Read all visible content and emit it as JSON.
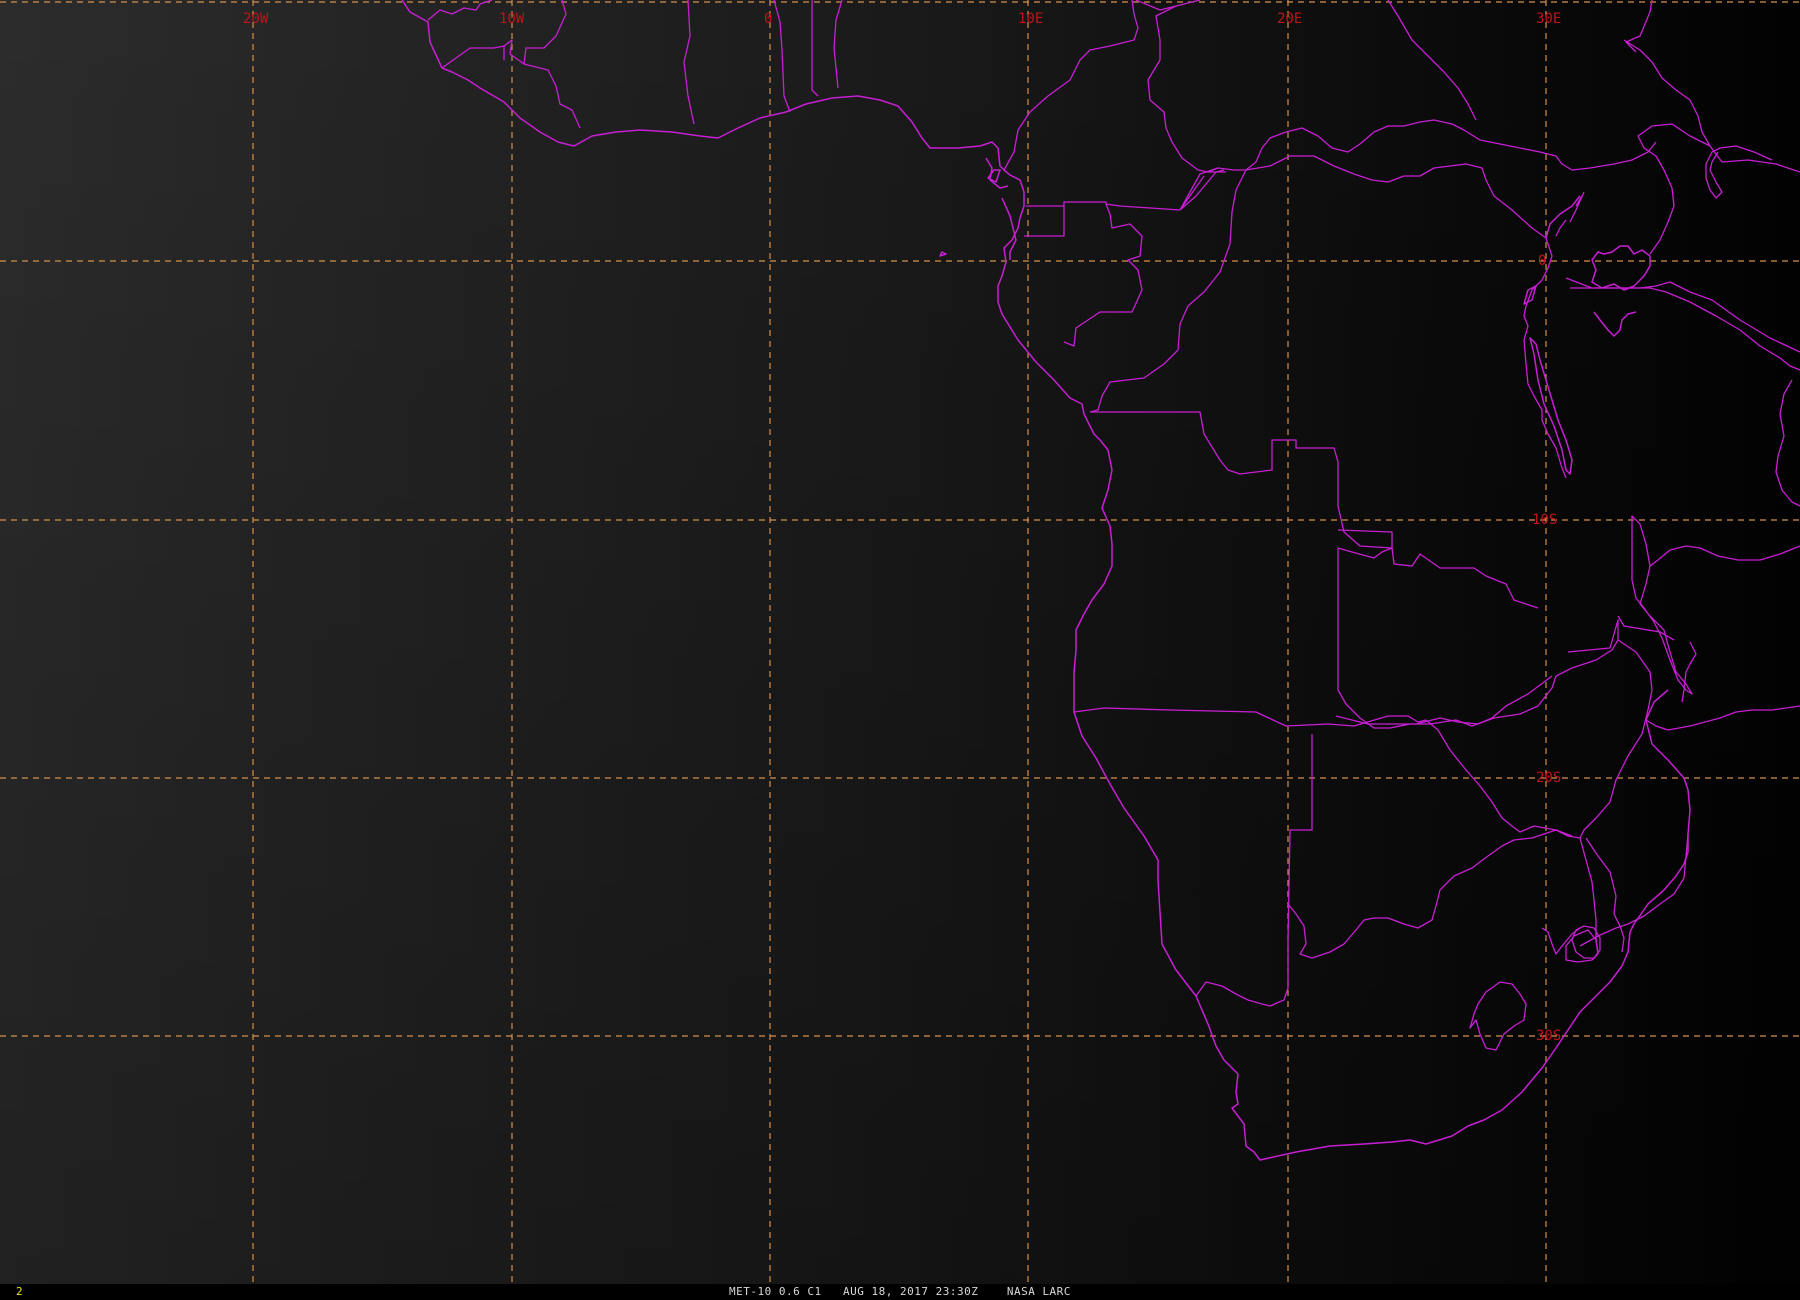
{
  "map": {
    "grid_longitude_labels": [
      "20W",
      "10W",
      "0",
      "10E",
      "20E",
      "30E"
    ],
    "grid_latitude_labels": [
      "0",
      "10S",
      "20S",
      "30S"
    ],
    "colors": {
      "background_light": "#2c2c2c",
      "background_dark": "#030303",
      "grid": "#d4904a",
      "grid_label": "#c0141a",
      "boundaries": "#c81fd4"
    },
    "boundary_layers": [
      "coastline",
      "country-borders",
      "lakes"
    ]
  },
  "status_bar": {
    "frame_number": "2",
    "caption": "MET-10 0.6 C1   AUG 18, 2017 23:30Z    NASA LARC"
  }
}
